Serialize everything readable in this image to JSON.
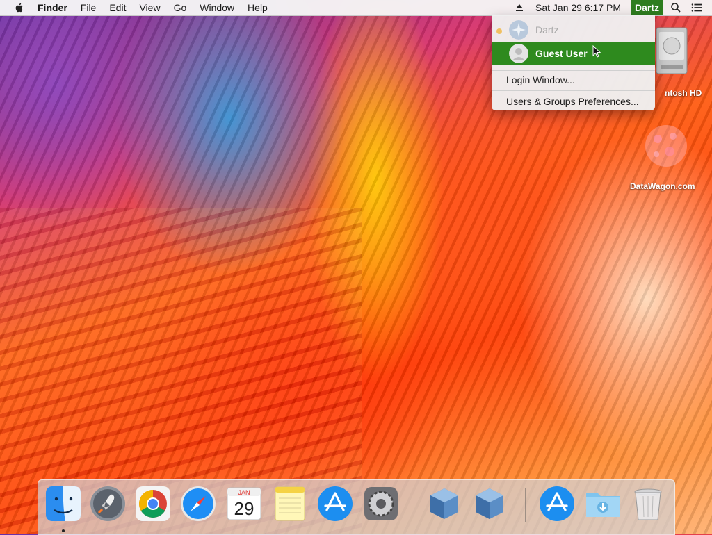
{
  "menubar": {
    "app_name": "Finder",
    "menus": [
      "File",
      "Edit",
      "View",
      "Go",
      "Window",
      "Help"
    ],
    "datetime": "Sat Jan 29  6:17 PM",
    "current_user": "Dartz"
  },
  "user_menu": {
    "users": [
      {
        "name": "Dartz",
        "state": "disabled"
      },
      {
        "name": "Guest User",
        "state": "highlighted"
      }
    ],
    "items": [
      "Login Window...",
      "Users & Groups Preferences..."
    ]
  },
  "desktop": {
    "hd_label": "ntosh HD",
    "datawagon_label": "DataWagon.com"
  },
  "dock": {
    "apps": [
      "finder",
      "launchpad",
      "chrome",
      "safari",
      "calendar",
      "notes",
      "app-store",
      "system-preferences",
      "virtualbox-1",
      "virtualbox-2",
      "app-store-downloads",
      "downloads-folder",
      "trash"
    ],
    "calendar": {
      "month": "JAN",
      "day": "29"
    }
  },
  "colors": {
    "menu_highlight": "#2e8a1e",
    "user_item_bg": "#2e7d1f"
  }
}
